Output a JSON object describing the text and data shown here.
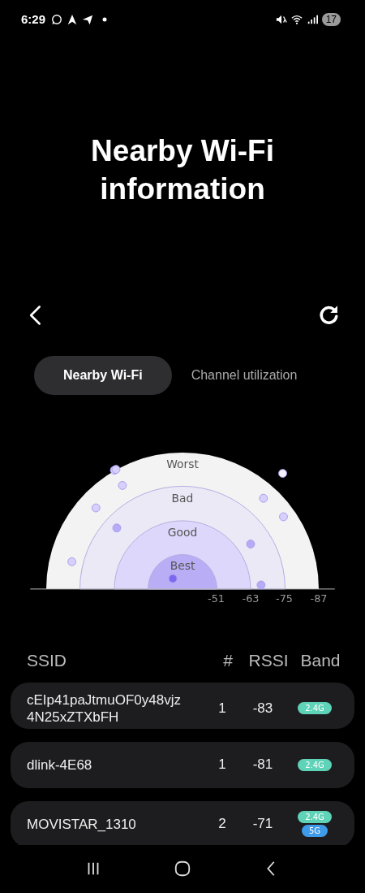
{
  "status_bar": {
    "time": "6:29",
    "battery": "17"
  },
  "title": "Nearby Wi-Fi information",
  "tabs": [
    {
      "label": "Nearby Wi-Fi",
      "selected": true
    },
    {
      "label": "Channel utilization",
      "selected": false
    }
  ],
  "radar": {
    "zones": [
      "Worst",
      "Bad",
      "Good",
      "Best"
    ],
    "ticks": [
      "-51",
      "-63",
      "-75",
      "-87"
    ]
  },
  "table": {
    "columns": [
      "SSID",
      "#",
      "RSSI",
      "Band"
    ],
    "rows": [
      {
        "ssid": "cEIp41paJtmuOF0y48vjz 4N25xZTXbFH",
        "channel": "1",
        "rssi": "-83",
        "bands": [
          {
            "label": "2.4G",
            "color": "#5fd3b8"
          }
        ]
      },
      {
        "ssid": "dlink-4E68",
        "channel": "1",
        "rssi": "-81",
        "bands": [
          {
            "label": "2.4G",
            "color": "#5fd3b8"
          }
        ]
      },
      {
        "ssid": "MOVISTAR_1310",
        "channel": "2",
        "rssi": "-71",
        "bands": [
          {
            "label": "2.4G",
            "color": "#5fd3b8"
          },
          {
            "label": "5G",
            "color": "#3f9ae8"
          }
        ]
      }
    ]
  }
}
